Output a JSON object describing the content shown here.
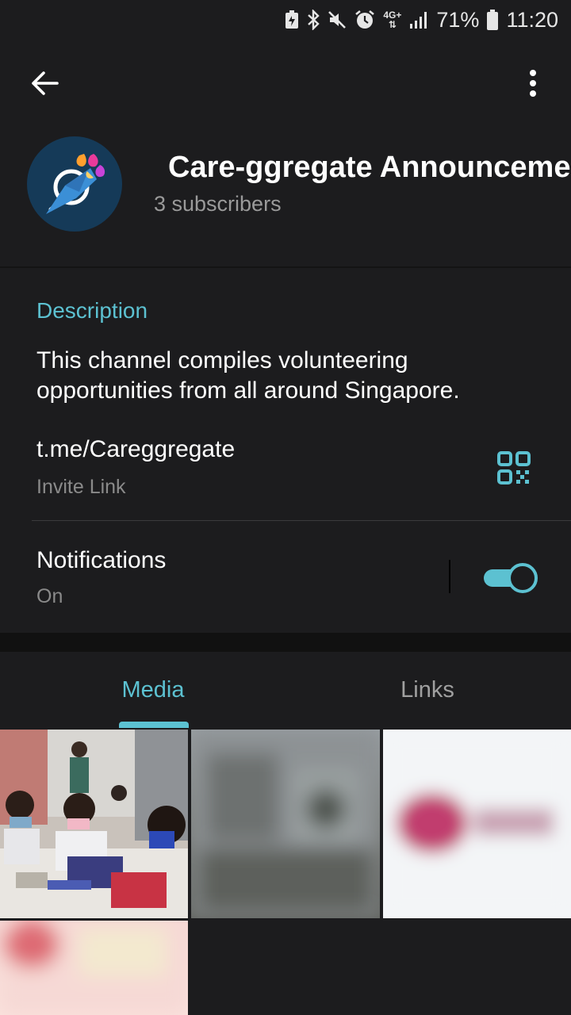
{
  "status_bar": {
    "battery_percent": "71%",
    "time": "11:20",
    "network": "4G+",
    "icons": [
      "battery-saver-icon",
      "bluetooth-icon",
      "mute-icon",
      "alarm-icon",
      "network-4g-icon",
      "signal-icon",
      "battery-icon"
    ]
  },
  "header": {
    "channel_title": "Care-ggregate Announceme",
    "subscribers": "3 subscribers"
  },
  "info": {
    "description_heading": "Description",
    "description_text": "This channel compiles volunteering opportunities from all around Singapore.",
    "invite_link": "t.me/Careggregate",
    "invite_link_label": "Invite Link",
    "notifications_label": "Notifications",
    "notifications_status": "On",
    "notifications_enabled": true
  },
  "tabs": {
    "media": "Media",
    "links": "Links",
    "selected": "media"
  },
  "colors": {
    "accent": "#5cc1d1",
    "background": "#1c1c1e",
    "secondary_text": "#9a9a9a"
  }
}
